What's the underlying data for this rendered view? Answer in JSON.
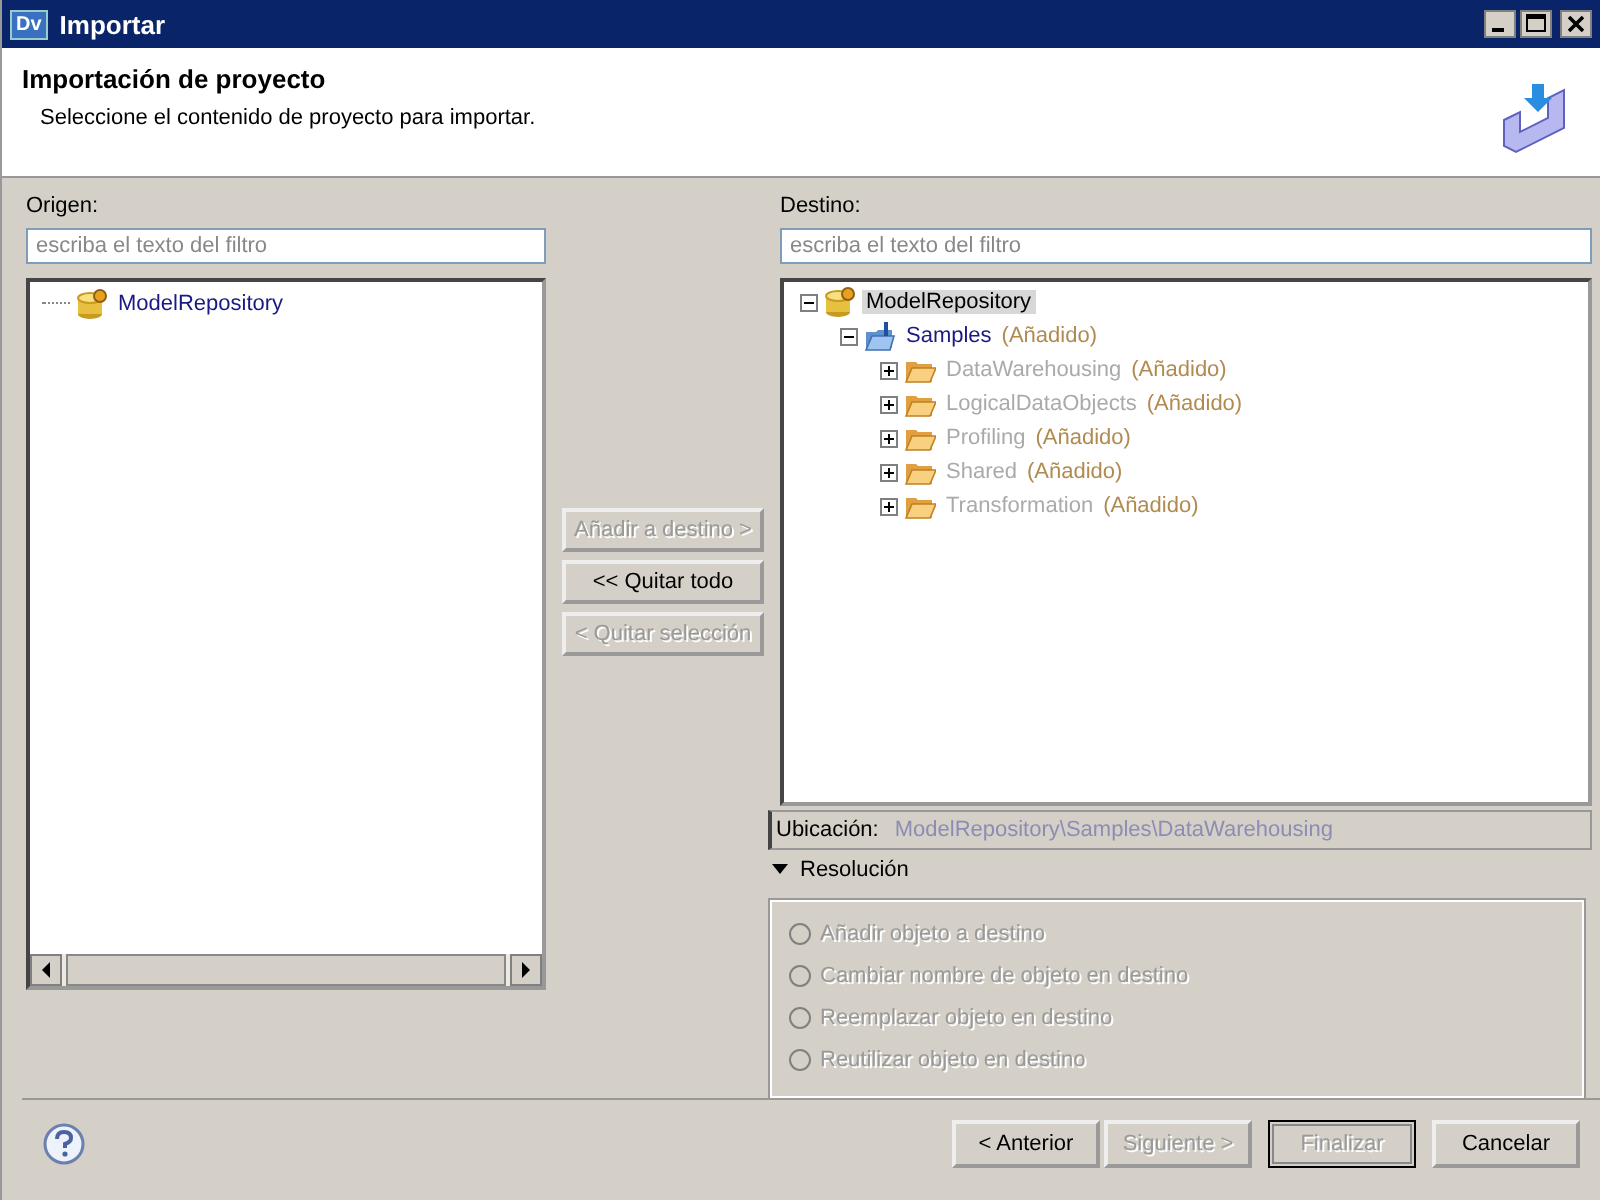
{
  "window": {
    "app_badge": "Dv",
    "title": "Importar"
  },
  "header": {
    "title": "Importación de proyecto",
    "subtitle": "Seleccione el contenido de proyecto para importar."
  },
  "source": {
    "label": "Origen:",
    "filter_placeholder": "escriba el texto del filtro",
    "tree": [
      {
        "kind": "repository",
        "label": "ModelRepository",
        "selected": false,
        "disabled": false
      }
    ]
  },
  "transfer_buttons": [
    {
      "label": "Añadir a destino >",
      "disabled": true
    },
    {
      "label": "<< Quitar todo",
      "disabled": false
    },
    {
      "label": "< Quitar selección",
      "disabled": true
    }
  ],
  "destination": {
    "label": "Destino:",
    "filter_placeholder": "escriba el texto del filtro",
    "tree": [
      {
        "kind": "repository",
        "label": "ModelRepository",
        "expanded": true,
        "selected": true,
        "disabled": false,
        "children": [
          {
            "kind": "project",
            "label": "Samples",
            "status": "(Añadido)",
            "expanded": true,
            "selected": false,
            "disabled": false,
            "children": [
              {
                "kind": "folder",
                "label": "DataWarehousing",
                "status": "(Añadido)",
                "expanded": false,
                "selected": false,
                "disabled": true
              },
              {
                "kind": "folder",
                "label": "LogicalDataObjects",
                "status": "(Añadido)",
                "expanded": false,
                "selected": false,
                "disabled": true
              },
              {
                "kind": "folder",
                "label": "Profiling",
                "status": "(Añadido)",
                "expanded": false,
                "selected": false,
                "disabled": true
              },
              {
                "kind": "folder",
                "label": "Shared",
                "status": "(Añadido)",
                "expanded": false,
                "selected": false,
                "disabled": true
              },
              {
                "kind": "folder",
                "label": "Transformation",
                "status": "(Añadido)",
                "expanded": false,
                "selected": false,
                "disabled": true
              }
            ]
          }
        ]
      }
    ]
  },
  "location": {
    "label": "Ubicación:",
    "value": "ModelRepository\\Samples\\DataWarehousing"
  },
  "resolution": {
    "label": "Resolución",
    "expanded": true,
    "options": [
      {
        "label": "Añadir objeto a destino",
        "selected": false,
        "disabled": true
      },
      {
        "label": "Cambiar nombre de objeto en destino",
        "selected": false,
        "disabled": true
      },
      {
        "label": "Reemplazar objeto en destino",
        "selected": false,
        "disabled": true
      },
      {
        "label": "Reutilizar objeto en destino",
        "selected": false,
        "disabled": true
      }
    ]
  },
  "footer_buttons": [
    {
      "label": "< Anterior",
      "disabled": false,
      "default": false
    },
    {
      "label": "Siguiente >",
      "disabled": true,
      "default": false
    },
    {
      "label": "Finalizar",
      "disabled": true,
      "default": true
    },
    {
      "label": "Cancelar",
      "disabled": false,
      "default": false
    }
  ]
}
